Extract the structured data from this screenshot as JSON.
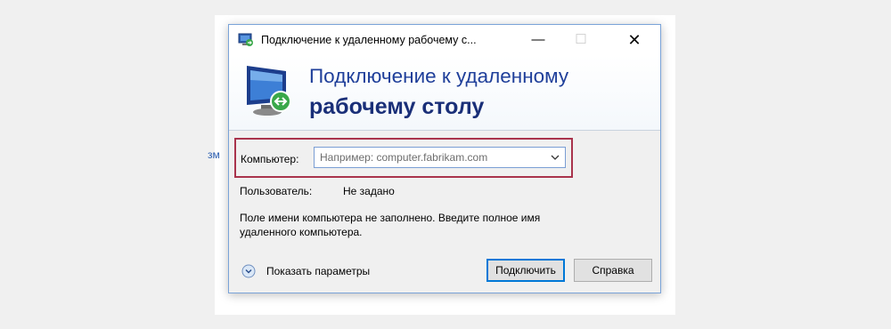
{
  "background": {
    "fragment_text": "зм"
  },
  "window": {
    "title": "Подключение к удаленному рабочему с...",
    "controls": {
      "minimize": "—",
      "maximize": "☐",
      "close": "✕"
    }
  },
  "banner": {
    "line1": "Подключение к удаленному",
    "line2": "рабочему столу"
  },
  "form": {
    "computer_label": "Компьютер:",
    "computer_placeholder": "Например: computer.fabrikam.com",
    "user_label": "Пользователь:",
    "user_value": "Не задано",
    "message": "Поле имени компьютера не заполнено. Введите полное имя удаленного компьютера."
  },
  "footer": {
    "show_options": "Показать параметры",
    "connect_button": "Подключить",
    "help_button": "Справка"
  },
  "colors": {
    "highlight_border": "#a9334c",
    "banner_title": "#1f3f9a",
    "default_button_border": "#0078d7"
  },
  "icons": {
    "title": "remote-desktop-icon",
    "banner": "remote-desktop-monitor-icon",
    "dropdown": "chevron-down-icon",
    "show_options": "expand-circle-icon"
  }
}
